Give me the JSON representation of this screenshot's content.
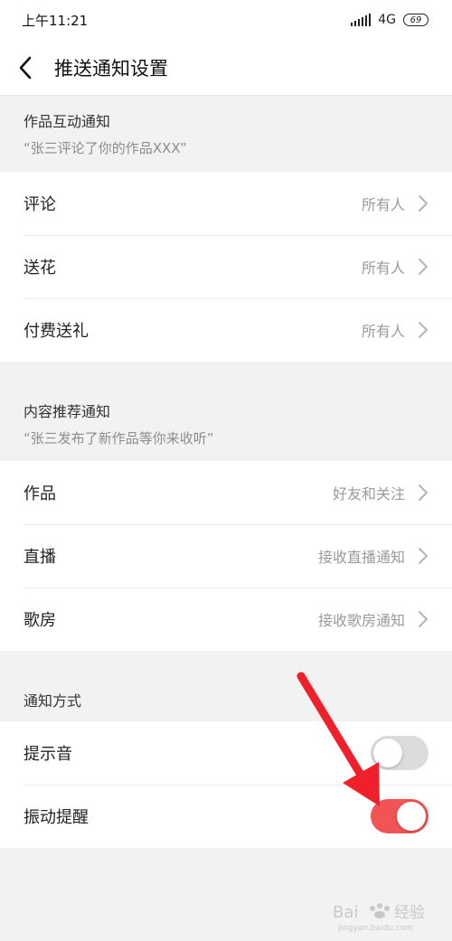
{
  "status_bar": {
    "time": "上午11:21",
    "network": "4G",
    "battery": "69"
  },
  "header": {
    "title": "推送通知设置"
  },
  "sections": [
    {
      "title": "作品互动通知",
      "subtitle": "“张三评论了你的作品XXX”",
      "items": [
        {
          "label": "评论",
          "value": "所有人"
        },
        {
          "label": "送花",
          "value": "所有人"
        },
        {
          "label": "付费送礼",
          "value": "所有人"
        }
      ]
    },
    {
      "title": "内容推荐通知",
      "subtitle": "“张三发布了新作品等你来收听”",
      "items": [
        {
          "label": "作品",
          "value": "好友和关注"
        },
        {
          "label": "直播",
          "value": "接收直播通知"
        },
        {
          "label": "歌房",
          "value": "接收歌房通知"
        }
      ]
    },
    {
      "title": "通知方式",
      "items": [
        {
          "label": "提示音",
          "enabled": false
        },
        {
          "label": "振动提醒",
          "enabled": true
        }
      ]
    }
  ],
  "colors": {
    "accent": "#f05454",
    "toggle_off": "#dcdcdc",
    "annotation_arrow": "#f0202a"
  },
  "watermark": {
    "text": "Bai 经验",
    "url": "jingyan.baidu.com"
  }
}
